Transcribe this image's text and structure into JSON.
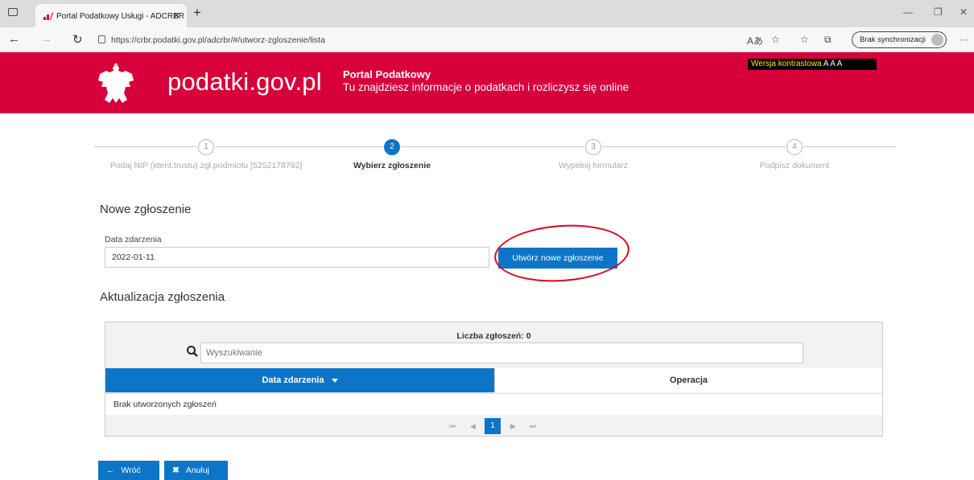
{
  "browser": {
    "tab_title": "Portal Podatkowy Usługi - ADCRBR",
    "url": "https://crbr.podatki.gov.pl/adcrbr/#/utworz-zgloszenie/lista",
    "sync_label": "Brak synchronizacji"
  },
  "header": {
    "logo_text": "podatki.gov.pl",
    "portal_title": "Portal Podatkowy",
    "portal_subtitle": "Tu znajdziesz informacje o podatkach i rozliczysz się online",
    "contrast_label": "Wersja kontrastowa",
    "font_sizes": "A A A"
  },
  "steps": [
    {
      "num": "1",
      "label": "Podaj NIP (ident.trustu) zgł.podmiotu [5252178792]"
    },
    {
      "num": "2",
      "label": "Wybierz zgłoszenie"
    },
    {
      "num": "3",
      "label": "Wypełnij formularz"
    },
    {
      "num": "4",
      "label": "Podpisz dokument"
    }
  ],
  "new_report": {
    "heading": "Nowe zgłoszenie",
    "date_label": "Data zdarzenia",
    "date_value": "2022-01-11",
    "create_button": "Utwórz nowe zgłoszenie"
  },
  "update": {
    "heading": "Aktualizacja zgłoszenia",
    "count_label": "Liczba zgłoszeń: 0",
    "search_placeholder": "Wyszukiwanie",
    "col_date": "Data zdarzenia",
    "col_operation": "Operacja",
    "empty_message": "Brak utworzonych zgłoszeń",
    "current_page": "1"
  },
  "actions": {
    "back": "Wróć",
    "cancel": "Anuluj"
  },
  "colors": {
    "brand_red": "#d7003a",
    "primary_blue": "#0d75c8",
    "highlight_red": "#e0001b"
  }
}
